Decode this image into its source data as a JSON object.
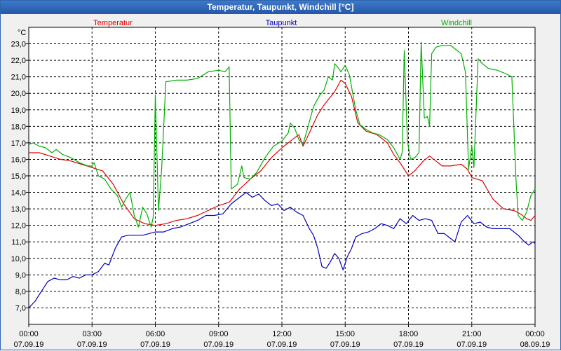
{
  "window": {
    "title": "Temperatur, Taupunkt, Windchill [°C]"
  },
  "chart_data": {
    "type": "line",
    "title": "Temperatur, Taupunkt, Windchill [°C]",
    "ylabel": "°C",
    "ylim": [
      6.0,
      24.0
    ],
    "y_ticks": [
      "23,0",
      "22,0",
      "21,0",
      "20,0",
      "19,0",
      "18,0",
      "17,0",
      "16,0",
      "15,0",
      "14,0",
      "13,0",
      "12,0",
      "11,0",
      "10,0",
      "9,0",
      "8,0",
      "7,0"
    ],
    "x_unit": "hours since 07.09.19 00:00",
    "xlim": [
      0,
      24
    ],
    "x_ticks": [
      {
        "time": "00:00",
        "date": "07.09.19"
      },
      {
        "time": "03:00",
        "date": "07.09.19"
      },
      {
        "time": "06:00",
        "date": "07.09.19"
      },
      {
        "time": "09:00",
        "date": "07.09.19"
      },
      {
        "time": "12:00",
        "date": "07.09.19"
      },
      {
        "time": "15:00",
        "date": "07.09.19"
      },
      {
        "time": "18:00",
        "date": "07.09.19"
      },
      {
        "time": "21:00",
        "date": "07.09.19"
      },
      {
        "time": "00:00",
        "date": "08.09.19"
      }
    ],
    "grid": true,
    "legend": "top",
    "series": [
      {
        "name": "Temperatur",
        "color": "#e00000",
        "points": [
          [
            0,
            16.4
          ],
          [
            0.5,
            16.4
          ],
          [
            1,
            16.2
          ],
          [
            1.5,
            16.0
          ],
          [
            2,
            15.9
          ],
          [
            2.5,
            15.7
          ],
          [
            3,
            15.5
          ],
          [
            3.5,
            15.3
          ],
          [
            4,
            14.5
          ],
          [
            4.5,
            13.3
          ],
          [
            5,
            12.4
          ],
          [
            5.5,
            12.1
          ],
          [
            6,
            12.0
          ],
          [
            6.5,
            12.1
          ],
          [
            7,
            12.3
          ],
          [
            7.5,
            12.4
          ],
          [
            8,
            12.6
          ],
          [
            8.5,
            12.9
          ],
          [
            9,
            13.2
          ],
          [
            9.5,
            13.4
          ],
          [
            10,
            14.2
          ],
          [
            10.5,
            14.8
          ],
          [
            11,
            15.3
          ],
          [
            11.5,
            16.1
          ],
          [
            12,
            16.7
          ],
          [
            12.5,
            17.2
          ],
          [
            12.8,
            17.5
          ],
          [
            13.0,
            16.8
          ],
          [
            13.3,
            17.6
          ],
          [
            13.7,
            18.7
          ],
          [
            14,
            19.3
          ],
          [
            14.5,
            20.1
          ],
          [
            14.8,
            20.8
          ],
          [
            15,
            20.6
          ],
          [
            15.3,
            19.8
          ],
          [
            15.6,
            18.2
          ],
          [
            16,
            17.7
          ],
          [
            16.5,
            17.5
          ],
          [
            17,
            17.0
          ],
          [
            17.3,
            16.3
          ],
          [
            17.6,
            15.8
          ],
          [
            18,
            15.0
          ],
          [
            18.3,
            15.3
          ],
          [
            18.7,
            15.9
          ],
          [
            19,
            16.2
          ],
          [
            19.3,
            15.9
          ],
          [
            19.6,
            15.6
          ],
          [
            20,
            15.6
          ],
          [
            20.5,
            15.7
          ],
          [
            20.8,
            15.4
          ],
          [
            21,
            14.9
          ],
          [
            21.5,
            14.7
          ],
          [
            22,
            13.6
          ],
          [
            22.5,
            13.0
          ],
          [
            23,
            12.9
          ],
          [
            23.3,
            12.7
          ],
          [
            23.6,
            12.4
          ],
          [
            23.8,
            12.3
          ],
          [
            24,
            12.6
          ]
        ]
      },
      {
        "name": "Taupunkt",
        "color": "#0000c0",
        "points": [
          [
            0,
            7.0
          ],
          [
            0.3,
            7.4
          ],
          [
            0.6,
            8.0
          ],
          [
            0.9,
            8.6
          ],
          [
            1.2,
            8.8
          ],
          [
            1.5,
            8.7
          ],
          [
            1.8,
            8.7
          ],
          [
            2.1,
            8.9
          ],
          [
            2.4,
            8.8
          ],
          [
            2.7,
            9.0
          ],
          [
            3,
            9.0
          ],
          [
            3.3,
            9.2
          ],
          [
            3.6,
            9.7
          ],
          [
            3.8,
            9.6
          ],
          [
            4.1,
            10.6
          ],
          [
            4.4,
            11.3
          ],
          [
            4.7,
            11.4
          ],
          [
            5,
            11.4
          ],
          [
            5.4,
            11.4
          ],
          [
            5.7,
            11.5
          ],
          [
            6,
            11.6
          ],
          [
            6.4,
            11.6
          ],
          [
            6.8,
            11.8
          ],
          [
            7.2,
            11.9
          ],
          [
            7.6,
            12.1
          ],
          [
            8,
            12.3
          ],
          [
            8.4,
            12.6
          ],
          [
            8.8,
            12.6
          ],
          [
            9.2,
            12.7
          ],
          [
            9.6,
            13.3
          ],
          [
            10,
            13.7
          ],
          [
            10.3,
            14.0
          ],
          [
            10.6,
            13.7
          ],
          [
            10.9,
            13.9
          ],
          [
            11.2,
            13.5
          ],
          [
            11.5,
            13.2
          ],
          [
            11.8,
            13.3
          ],
          [
            12.1,
            12.9
          ],
          [
            12.4,
            13.1
          ],
          [
            12.7,
            12.8
          ],
          [
            13,
            12.6
          ],
          [
            13.3,
            11.8
          ],
          [
            13.5,
            11.4
          ],
          [
            13.7,
            10.6
          ],
          [
            13.9,
            9.5
          ],
          [
            14.1,
            9.4
          ],
          [
            14.3,
            9.8
          ],
          [
            14.5,
            10.3
          ],
          [
            14.7,
            10.0
          ],
          [
            14.9,
            9.3
          ],
          [
            15.1,
            10.1
          ],
          [
            15.3,
            10.6
          ],
          [
            15.5,
            11.3
          ],
          [
            15.8,
            11.5
          ],
          [
            16.1,
            11.6
          ],
          [
            16.4,
            11.8
          ],
          [
            16.7,
            12.1
          ],
          [
            17,
            12.0
          ],
          [
            17.3,
            11.8
          ],
          [
            17.6,
            12.4
          ],
          [
            17.9,
            12.1
          ],
          [
            18.2,
            12.6
          ],
          [
            18.5,
            12.3
          ],
          [
            18.8,
            12.4
          ],
          [
            19.1,
            12.3
          ],
          [
            19.4,
            11.5
          ],
          [
            19.7,
            11.5
          ],
          [
            20,
            11.2
          ],
          [
            20.2,
            11.0
          ],
          [
            20.5,
            12.2
          ],
          [
            20.8,
            12.6
          ],
          [
            21.1,
            12.1
          ],
          [
            21.4,
            12.2
          ],
          [
            21.7,
            11.9
          ],
          [
            22,
            11.8
          ],
          [
            22.4,
            11.8
          ],
          [
            22.8,
            11.8
          ],
          [
            23.2,
            11.4
          ],
          [
            23.5,
            11.0
          ],
          [
            23.7,
            10.8
          ],
          [
            23.9,
            11.0
          ],
          [
            24,
            10.9
          ]
        ]
      },
      {
        "name": "Windchill",
        "color": "#00b000",
        "points": [
          [
            0,
            16.9
          ],
          [
            0.2,
            17.0
          ],
          [
            0.5,
            16.8
          ],
          [
            0.8,
            16.7
          ],
          [
            1.1,
            16.4
          ],
          [
            1.3,
            16.6
          ],
          [
            1.6,
            16.3
          ],
          [
            2,
            16.1
          ],
          [
            2.4,
            15.8
          ],
          [
            2.8,
            15.6
          ],
          [
            3,
            15.6
          ],
          [
            3.1,
            15.8
          ],
          [
            3.3,
            15.0
          ],
          [
            3.6,
            14.8
          ],
          [
            3.9,
            14.2
          ],
          [
            4.2,
            13.8
          ],
          [
            4.4,
            13.1
          ],
          [
            4.6,
            13.6
          ],
          [
            4.8,
            14.0
          ],
          [
            5.0,
            12.6
          ],
          [
            5.2,
            11.9
          ],
          [
            5.4,
            13.1
          ],
          [
            5.6,
            12.7
          ],
          [
            5.8,
            11.9
          ],
          [
            5.9,
            12.5
          ],
          [
            6.0,
            19.9
          ],
          [
            6.15,
            12.9
          ],
          [
            6.3,
            15.4
          ],
          [
            6.5,
            20.7
          ],
          [
            7,
            20.8
          ],
          [
            7.5,
            20.8
          ],
          [
            8,
            20.9
          ],
          [
            8.5,
            21.3
          ],
          [
            9,
            21.4
          ],
          [
            9.3,
            21.3
          ],
          [
            9.5,
            21.6
          ],
          [
            9.6,
            14.2
          ],
          [
            9.9,
            14.5
          ],
          [
            10.1,
            15.6
          ],
          [
            10.2,
            14.9
          ],
          [
            10.5,
            14.8
          ],
          [
            10.8,
            15.2
          ],
          [
            11.2,
            16.1
          ],
          [
            11.6,
            16.8
          ],
          [
            12,
            17.1
          ],
          [
            12.3,
            17.6
          ],
          [
            12.4,
            18.2
          ],
          [
            12.6,
            17.9
          ],
          [
            12.8,
            17.2
          ],
          [
            13,
            16.9
          ],
          [
            13.2,
            17.8
          ],
          [
            13.5,
            19.2
          ],
          [
            13.8,
            19.9
          ],
          [
            14,
            20.2
          ],
          [
            14.2,
            21.0
          ],
          [
            14.4,
            20.8
          ],
          [
            14.5,
            21.8
          ],
          [
            14.7,
            21.5
          ],
          [
            14.8,
            21.3
          ],
          [
            15.0,
            21.7
          ],
          [
            15.2,
            21.1
          ],
          [
            15.5,
            19.0
          ],
          [
            15.7,
            18.1
          ],
          [
            16,
            17.8
          ],
          [
            16.3,
            17.6
          ],
          [
            16.6,
            17.5
          ],
          [
            17,
            17.2
          ],
          [
            17.3,
            16.7
          ],
          [
            17.6,
            16.0
          ],
          [
            17.7,
            16.4
          ],
          [
            17.8,
            22.6
          ],
          [
            17.95,
            17.1
          ],
          [
            18.1,
            16.0
          ],
          [
            18.3,
            16.1
          ],
          [
            18.5,
            16.4
          ],
          [
            18.6,
            23.1
          ],
          [
            18.75,
            18.5
          ],
          [
            18.9,
            18.6
          ],
          [
            19,
            18.0
          ],
          [
            19.1,
            22.4
          ],
          [
            19.3,
            22.8
          ],
          [
            19.6,
            22.9
          ],
          [
            20,
            22.9
          ],
          [
            20.2,
            22.7
          ],
          [
            20.5,
            22.4
          ],
          [
            20.7,
            21.3
          ],
          [
            20.85,
            15.4
          ],
          [
            21,
            16.8
          ],
          [
            21.1,
            15.5
          ],
          [
            21.3,
            22.1
          ],
          [
            21.5,
            21.8
          ],
          [
            21.8,
            21.5
          ],
          [
            22.2,
            21.4
          ],
          [
            22.6,
            21.2
          ],
          [
            22.9,
            21.0
          ],
          [
            23.1,
            14.7
          ],
          [
            23.2,
            12.6
          ],
          [
            23.4,
            12.3
          ],
          [
            23.6,
            12.8
          ],
          [
            23.8,
            13.8
          ],
          [
            24,
            14.2
          ]
        ]
      }
    ]
  }
}
